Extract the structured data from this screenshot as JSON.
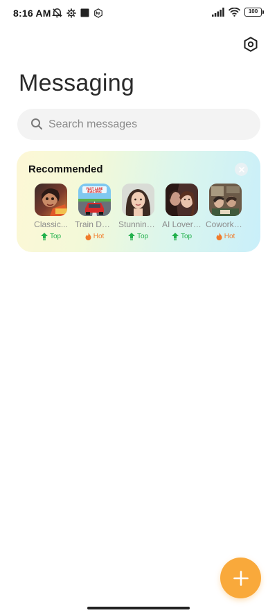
{
  "status_bar": {
    "time": "8:16 AM",
    "left_icons": [
      "muted-notification-icon",
      "gear-outline-icon",
      "square-icon",
      "nfc-badge-icon"
    ],
    "right_icons": [
      "signal-icon",
      "wifi-icon"
    ],
    "battery": "100"
  },
  "header": {
    "title": "Messaging",
    "settings_icon": "settings-hex-icon"
  },
  "search": {
    "placeholder": "Search messages"
  },
  "recommended": {
    "title": "Recommended",
    "apps": [
      {
        "name": "Classic...",
        "tag": "Top",
        "tag_type": "top"
      },
      {
        "name": "Train Del...",
        "tag": "Hot",
        "tag_type": "hot"
      },
      {
        "name": "Stunning...",
        "tag": "Top",
        "tag_type": "top"
      },
      {
        "name": "AI Lover ...",
        "tag": "Top",
        "tag_type": "top"
      },
      {
        "name": "Coworke...",
        "tag": "Hot",
        "tag_type": "hot"
      }
    ]
  },
  "colors": {
    "accent": "#f9a93b",
    "tag_top": "#21b04b",
    "tag_hot": "#f07b2a"
  },
  "fab": {
    "icon": "plus-icon"
  }
}
